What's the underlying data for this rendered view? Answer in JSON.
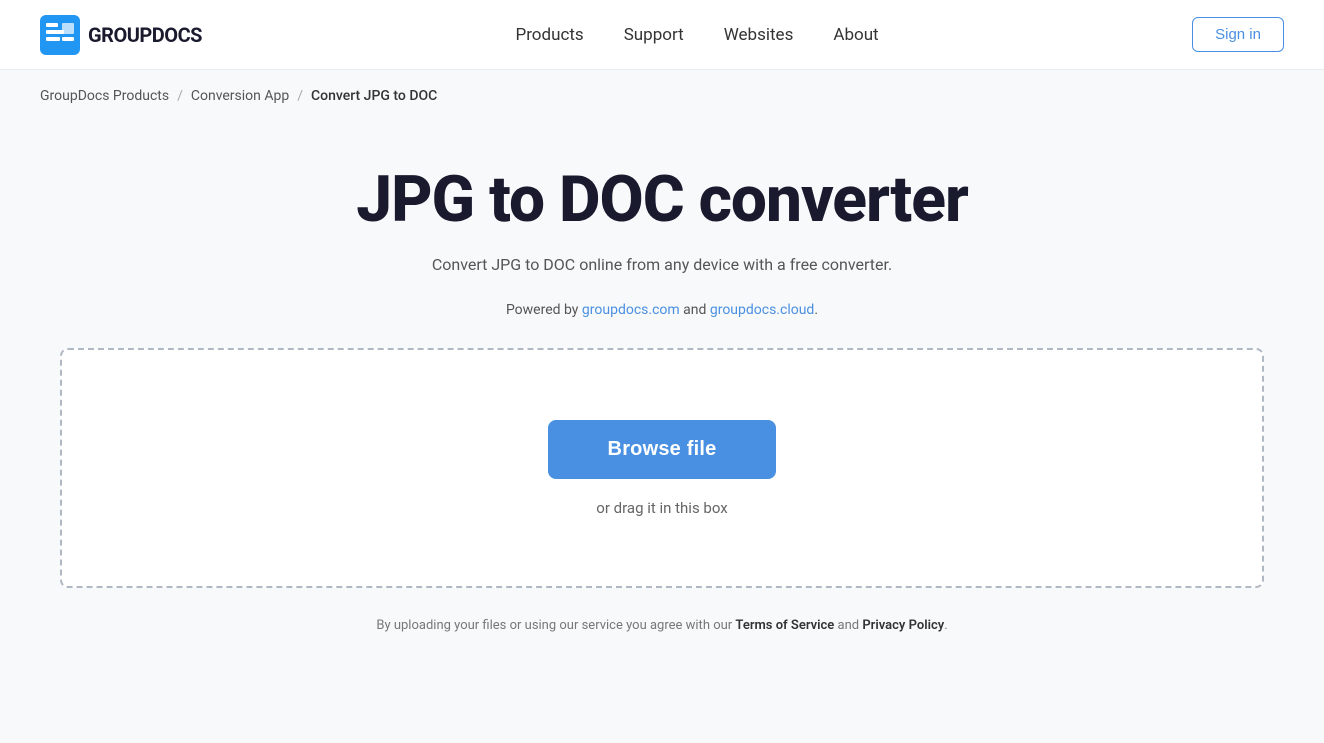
{
  "header": {
    "logo_text": "GROUPDOCS",
    "nav": {
      "items": [
        {
          "label": "Products",
          "id": "nav-products"
        },
        {
          "label": "Support",
          "id": "nav-support"
        },
        {
          "label": "Websites",
          "id": "nav-websites"
        },
        {
          "label": "About",
          "id": "nav-about"
        }
      ]
    },
    "signin_label": "Sign in"
  },
  "breadcrumb": {
    "items": [
      {
        "label": "GroupDocs Products",
        "id": "bc-home"
      },
      {
        "label": "Conversion App",
        "id": "bc-conversion"
      },
      {
        "label": "Convert JPG to DOC",
        "id": "bc-current"
      }
    ],
    "separator": "/"
  },
  "main": {
    "title": "JPG to DOC converter",
    "subtitle": "Convert JPG to DOC online from any device with a free converter.",
    "powered_by_prefix": "Powered by ",
    "powered_by_link1_text": "groupdocs.com",
    "powered_by_link1_href": "https://groupdocs.com",
    "powered_by_middle": " and ",
    "powered_by_link2_text": "groupdocs.cloud",
    "powered_by_link2_href": "https://groupdocs.cloud",
    "powered_by_suffix": ".",
    "dropzone": {
      "browse_label": "Browse file",
      "drag_text": "or drag it in this box"
    },
    "footer_note_prefix": "By uploading your files or using our service you agree with our ",
    "tos_label": "Terms of Service",
    "footer_note_middle": " and ",
    "privacy_label": "Privacy Policy",
    "footer_note_suffix": "."
  }
}
